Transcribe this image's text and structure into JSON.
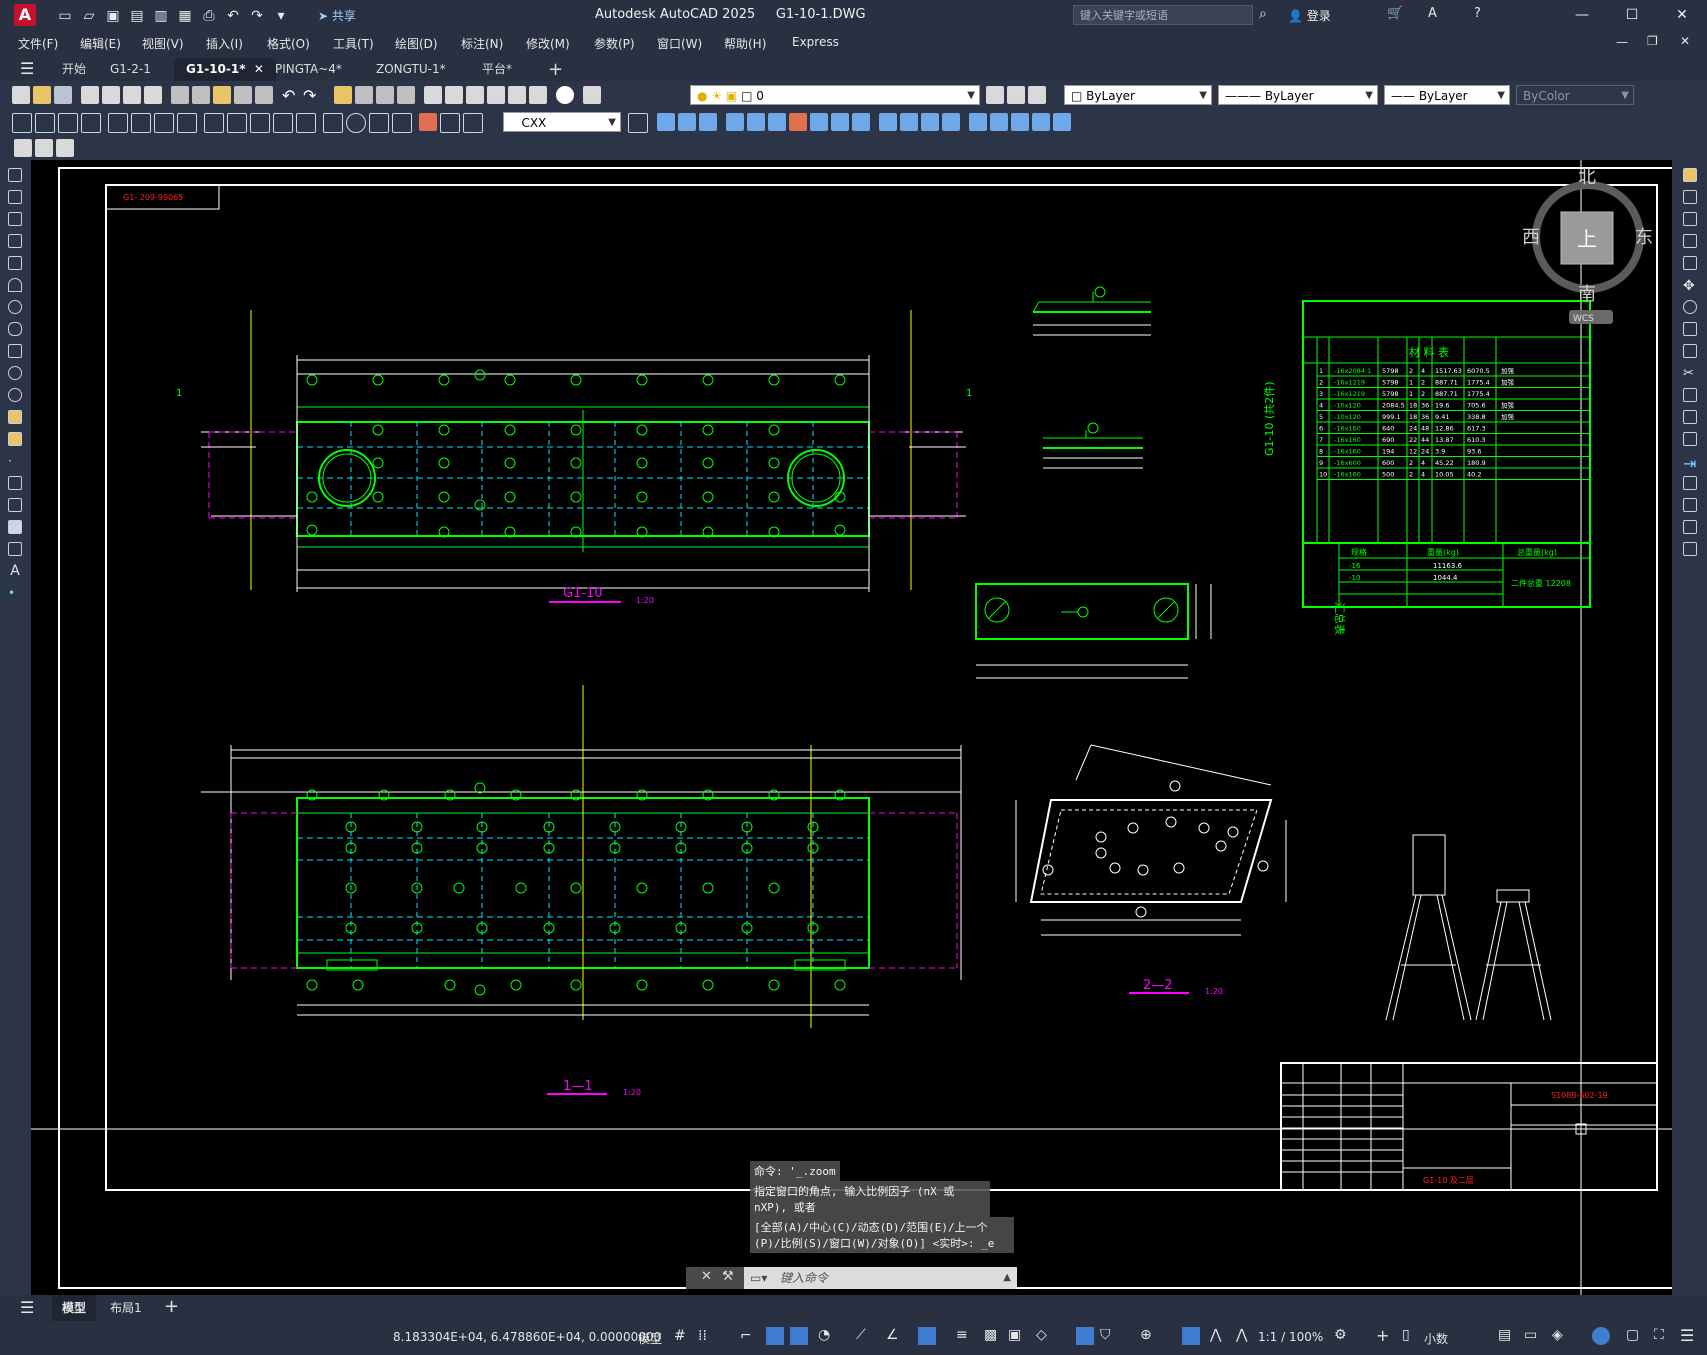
{
  "app": {
    "title_app": "Autodesk AutoCAD 2025",
    "title_file": "G1-10-1.DWG",
    "logo_letter": "A",
    "share_label": "共享",
    "search_placeholder": "键入关键字或短语",
    "login_label": "登录"
  },
  "menu": [
    "文件(F)",
    "编辑(E)",
    "视图(V)",
    "插入(I)",
    "格式(O)",
    "工具(T)",
    "绘图(D)",
    "标注(N)",
    "修改(M)",
    "参数(P)",
    "窗口(W)",
    "帮助(H)",
    "Express"
  ],
  "file_tabs": {
    "start": "开始",
    "tabs": [
      "G1-2-1",
      "G1-10-1*",
      "PINGTA~4*",
      "ZONGTU-1*",
      "平台*"
    ],
    "active_index": 1
  },
  "toolbar": {
    "layer_value": "0",
    "color_value": "ByLayer",
    "linetype_value": "ByLayer",
    "lineweight_value": "ByLayer",
    "plotstyle_value": "ByColor",
    "dimstyle_value": "CXX"
  },
  "viewcube": {
    "north": "北",
    "south": "南",
    "east": "东",
    "west": "西",
    "face": "上",
    "wcs": "WCS"
  },
  "drawing": {
    "label_top_left": "G1- 209-99065",
    "view_g1_10": "G1-10",
    "view_g1_10_scale": "1:20",
    "view_1_1": "1—1",
    "view_1_1_scale": "1:20",
    "view_2_2": "2—2",
    "view_2_2_scale": "1:20",
    "section_mark": "1",
    "bom_title": "材 料 表",
    "bom_side": "G1-10 (共2件)",
    "bom_rows": [
      [
        "1",
        "-16x2084.1",
        "5798",
        "2",
        "4",
        "1517.63",
        "6070.5",
        "加强"
      ],
      [
        "2",
        "-16x1219",
        "5798",
        "1",
        "2",
        "887.71",
        "1775.4",
        "加强"
      ],
      [
        "3",
        "-16x1219",
        "5798",
        "1",
        "2",
        "887.71",
        "1775.4",
        ""
      ],
      [
        "4",
        "-10x120",
        "2084.5",
        "18",
        "36",
        "19.6",
        "705.6",
        "加强"
      ],
      [
        "5",
        "-10x120",
        "999.1",
        "18",
        "36",
        "9.41",
        "338.8",
        "加强"
      ],
      [
        "6",
        "-16x160",
        "640",
        "24",
        "48",
        "12.86",
        "617.3",
        ""
      ],
      [
        "7",
        "-16x160",
        "690",
        "22",
        "44",
        "13.87",
        "610.3",
        ""
      ],
      [
        "8",
        "-16x160",
        "194",
        "12",
        "24",
        "3.9",
        "93.6",
        ""
      ],
      [
        "9",
        "-16x600",
        "600",
        "2",
        "4",
        "45.22",
        "180.9",
        ""
      ],
      [
        "10",
        "-16x160",
        "500",
        "2",
        "4",
        "10.05",
        "40.2",
        ""
      ]
    ],
    "summary_title": "汇总表",
    "summary_headers": [
      "规格",
      "重量(kg)",
      "总重量(kg)"
    ],
    "summary_rows": [
      [
        "-16",
        "11163.6"
      ],
      [
        "-10",
        "1044.4"
      ]
    ],
    "summary_total": "二件总重 12208",
    "titleblock_code": "S1088-602-19",
    "titleblock_name": "G1-10 及二层"
  },
  "command": {
    "line1": "命令: '_.zoom",
    "line2": "指定窗口的角点, 输入比例因子 (nX 或 nXP), 或者",
    "line3": "[全部(A)/中心(C)/动态(D)/范围(E)/上一个(P)/比例(S)/窗口(W)/对象(O)] <实时>: _e",
    "input_placeholder": "键入命令"
  },
  "layout_tabs": [
    "模型",
    "布局1"
  ],
  "status": {
    "coords": "8.183304E+04, 6.478860E+04, 0.00000000",
    "model": "模型",
    "scale": "1:1 / 100%",
    "units": "小数"
  },
  "colors": {
    "app_bg": "#1f2532",
    "canvas_bg": "#000000",
    "drawing_green": "#00ff00",
    "drawing_cyan": "#00e5ff",
    "drawing_magenta": "#ff00ff",
    "drawing_red": "#ff2020",
    "drawing_yellow": "#ffff00",
    "accent_red": "#c8102e"
  }
}
